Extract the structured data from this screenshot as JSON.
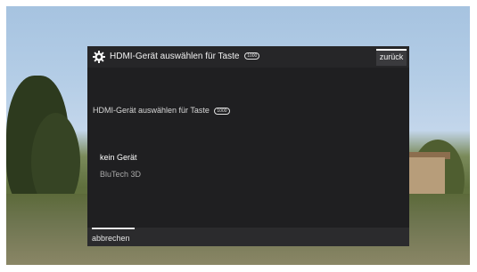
{
  "dialog": {
    "title": "HDMI-Gerät auswählen für Taste",
    "title_badge": "1000",
    "subtitle": "HDMI-Gerät auswählen für Taste",
    "subtitle_badge": "1000",
    "back_label": "zurück",
    "cancel_label": "abbrechen",
    "devices": [
      {
        "label": "kein Gerät",
        "selected": true
      },
      {
        "label": "BluTech 3D",
        "selected": false
      }
    ]
  },
  "icons": {
    "settings": "gear-icon",
    "key_badge": "remote-key-badge-icon"
  },
  "colors": {
    "dialog_bg": "#1f1f21",
    "header_bg": "#262628",
    "selected_text": "#ffffff",
    "normal_text": "#a9a9a9"
  }
}
